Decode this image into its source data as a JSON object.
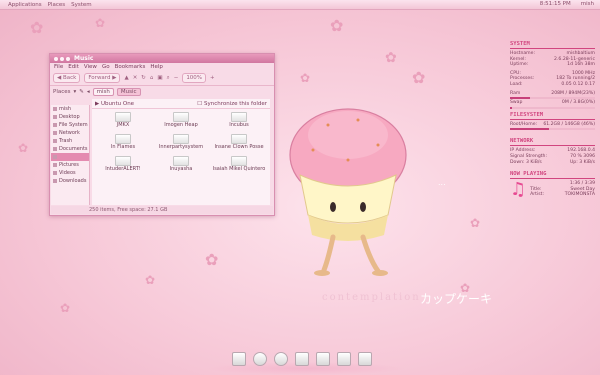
{
  "panel": {
    "menus": [
      "Applications",
      "Places",
      "System"
    ],
    "clock": "8:51:15 PM",
    "user": "mish"
  },
  "window": {
    "title": "Music",
    "menubar": [
      "File",
      "Edit",
      "View",
      "Go",
      "Bookmarks",
      "Help"
    ],
    "toolbar": {
      "back": "Back",
      "forward": "Forward",
      "zoom": "100%"
    },
    "places_label": "Places",
    "crumbs": [
      "mish",
      "Music"
    ],
    "pathbar": {
      "title": "Ubuntu One",
      "sync": "Synchronize this folder"
    },
    "sidebar": [
      "mish",
      "Desktop",
      "File System",
      "Network",
      "Trash",
      "Documents",
      "",
      "Pictures",
      "Videos",
      "Downloads"
    ],
    "files": [
      "JMKX",
      "Imogen Heap",
      "Incubus",
      "In Flames",
      "Innerpartysystem",
      "Insane Clown Posse",
      "IntuderALERT!",
      "Inuyasha",
      "Isaiah Mikel Quintero"
    ],
    "status": "250 items, Free space: 27.1 GB"
  },
  "wallpaper": {
    "caption_latin": "contemplation",
    "caption_jp": "カップケーキ",
    "ellipsis": "..."
  },
  "conky": {
    "system": {
      "head": "SYSTEM",
      "rows": [
        [
          "Hostname:",
          "mishbaltium"
        ],
        [
          "Kernel:",
          "2.6.28-11-generic"
        ],
        [
          "Uptime:",
          "1d 16h 38m"
        ],
        [
          "CPU:",
          "1000 MHz"
        ],
        [
          "Processes:",
          "182 To running/2"
        ],
        [
          "Load:",
          "0.05 0.12 0.17"
        ]
      ],
      "ram": [
        "Ram",
        "208M / 894M(23%)"
      ],
      "swap": [
        "Swap",
        "0M / 3.8G(0%)"
      ],
      "ram_frac": 0.23,
      "swap_frac": 0.02
    },
    "filesystem": {
      "head": "FILESYSTEM",
      "rows": [
        [
          "Root/Home:",
          "61.2G8 / 146G8 (46%)"
        ]
      ],
      "frac": 0.46
    },
    "network": {
      "head": "NETWORK",
      "rows": [
        [
          "IP Address:",
          "192.168.0.4"
        ],
        [
          "Signal Strength:",
          "70 % 3096"
        ],
        [
          "Down: 3 KiB/s",
          "Up: 3 KiB/s"
        ]
      ]
    },
    "now_playing": {
      "head": "NOW PLAYING",
      "rows": [
        [
          "",
          "1:36 / 3:39"
        ],
        [
          "Title:",
          "Sweet Day"
        ],
        [
          "Artist:",
          "TOKIMONSTA"
        ]
      ]
    }
  },
  "dock": [
    "finder-icon",
    "clock-icon",
    "chat-icon",
    "pen-icon",
    "text-icon",
    "notes-icon",
    "trash-icon"
  ]
}
